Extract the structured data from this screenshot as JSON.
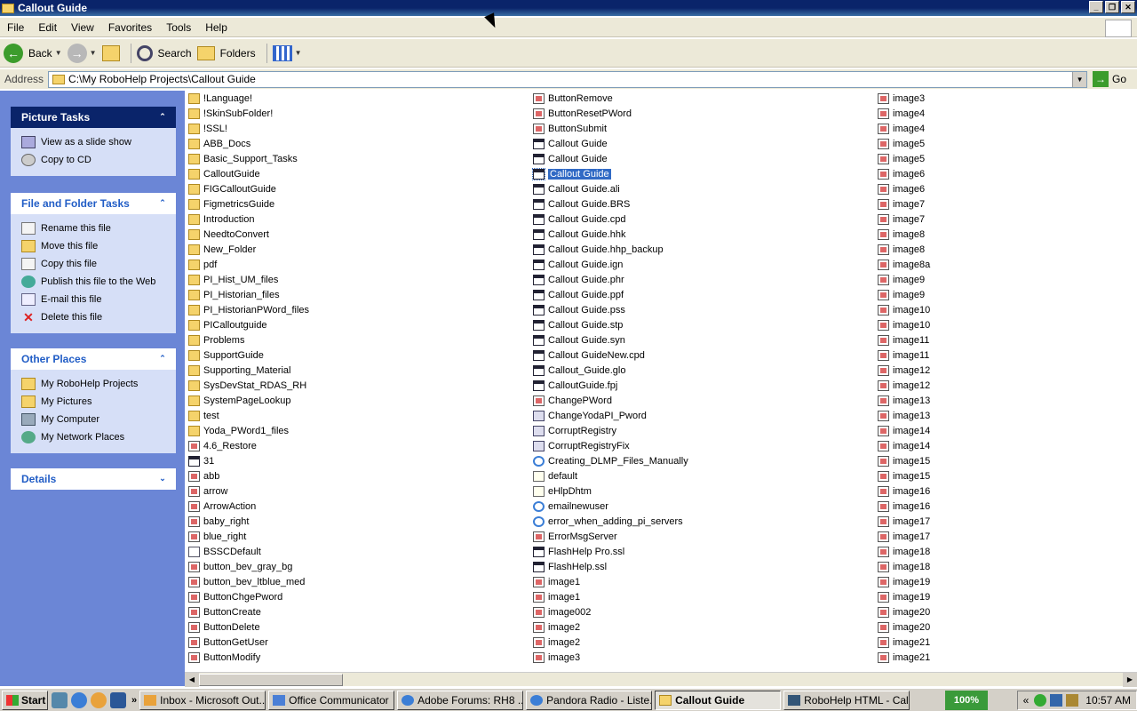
{
  "window": {
    "title": "Callout Guide"
  },
  "menu": [
    "File",
    "Edit",
    "View",
    "Favorites",
    "Tools",
    "Help"
  ],
  "toolbar": {
    "back": "Back",
    "search": "Search",
    "folders": "Folders"
  },
  "address": {
    "label": "Address",
    "value": "C:\\My RoboHelp Projects\\Callout Guide",
    "go": "Go"
  },
  "panels": {
    "picture_tasks": {
      "title": "Picture Tasks",
      "items": [
        "View as a slide show",
        "Copy to CD"
      ]
    },
    "file_tasks": {
      "title": "File and Folder Tasks",
      "items": [
        "Rename this file",
        "Move this file",
        "Copy this file",
        "Publish this file to the Web",
        "E-mail this file",
        "Delete this file"
      ]
    },
    "other_places": {
      "title": "Other Places",
      "items": [
        "My RoboHelp Projects",
        "My Pictures",
        "My Computer",
        "My Network Places"
      ]
    },
    "details": {
      "title": "Details"
    }
  },
  "columns": [
    [
      {
        "n": "!Language!",
        "t": "folder"
      },
      {
        "n": "!SkinSubFolder!",
        "t": "folder"
      },
      {
        "n": "!SSL!",
        "t": "folder"
      },
      {
        "n": "ABB_Docs",
        "t": "folder"
      },
      {
        "n": "Basic_Support_Tasks",
        "t": "folder"
      },
      {
        "n": "CalloutGuide",
        "t": "folder"
      },
      {
        "n": "FIGCalloutGuide",
        "t": "folder"
      },
      {
        "n": "FigmetricsGuide",
        "t": "folder"
      },
      {
        "n": "Introduction",
        "t": "folder"
      },
      {
        "n": "NeedtoConvert",
        "t": "folder"
      },
      {
        "n": "New_Folder",
        "t": "folder"
      },
      {
        "n": "pdf",
        "t": "folder"
      },
      {
        "n": "PI_Hist_UM_files",
        "t": "folder"
      },
      {
        "n": "PI_Historian_files",
        "t": "folder"
      },
      {
        "n": "PI_HistorianPWord_files",
        "t": "folder"
      },
      {
        "n": "PICalloutguide",
        "t": "folder"
      },
      {
        "n": "Problems",
        "t": "folder"
      },
      {
        "n": "SupportGuide",
        "t": "folder"
      },
      {
        "n": "Supporting_Material",
        "t": "folder"
      },
      {
        "n": "SysDevStat_RDAS_RH",
        "t": "folder"
      },
      {
        "n": "SystemPageLookup",
        "t": "folder"
      },
      {
        "n": "test",
        "t": "folder"
      },
      {
        "n": "Yoda_PWord1_files",
        "t": "folder"
      },
      {
        "n": "4.6_Restore",
        "t": "image"
      },
      {
        "n": "31",
        "t": "app"
      },
      {
        "n": "abb",
        "t": "image"
      },
      {
        "n": "arrow",
        "t": "image"
      },
      {
        "n": "ArrowAction",
        "t": "image"
      },
      {
        "n": "baby_right",
        "t": "image"
      },
      {
        "n": "blue_right",
        "t": "image"
      },
      {
        "n": "BSSCDefault",
        "t": "doc"
      },
      {
        "n": "button_bev_gray_bg",
        "t": "image"
      },
      {
        "n": "button_bev_ltblue_med",
        "t": "image"
      },
      {
        "n": "ButtonChgePword",
        "t": "image"
      },
      {
        "n": "ButtonCreate",
        "t": "image"
      },
      {
        "n": "ButtonDelete",
        "t": "image"
      },
      {
        "n": "ButtonGetUser",
        "t": "image"
      },
      {
        "n": "ButtonModify",
        "t": "image"
      }
    ],
    [
      {
        "n": "ButtonRemove",
        "t": "image"
      },
      {
        "n": "ButtonResetPWord",
        "t": "image"
      },
      {
        "n": "ButtonSubmit",
        "t": "image"
      },
      {
        "n": "Callout Guide",
        "t": "app"
      },
      {
        "n": "Callout Guide",
        "t": "app"
      },
      {
        "n": "Callout Guide",
        "t": "app",
        "sel": true
      },
      {
        "n": "Callout Guide.ali",
        "t": "app"
      },
      {
        "n": "Callout Guide.BRS",
        "t": "app"
      },
      {
        "n": "Callout Guide.cpd",
        "t": "app"
      },
      {
        "n": "Callout Guide.hhk",
        "t": "app"
      },
      {
        "n": "Callout Guide.hhp_backup",
        "t": "app"
      },
      {
        "n": "Callout Guide.ign",
        "t": "app"
      },
      {
        "n": "Callout Guide.phr",
        "t": "app"
      },
      {
        "n": "Callout Guide.ppf",
        "t": "app"
      },
      {
        "n": "Callout Guide.pss",
        "t": "app"
      },
      {
        "n": "Callout Guide.stp",
        "t": "app"
      },
      {
        "n": "Callout Guide.syn",
        "t": "app"
      },
      {
        "n": "Callout GuideNew.cpd",
        "t": "app"
      },
      {
        "n": "Callout_Guide.glo",
        "t": "app"
      },
      {
        "n": "CalloutGuide.fpj",
        "t": "app"
      },
      {
        "n": "ChangePWord",
        "t": "image"
      },
      {
        "n": "ChangeYodaPI_Pword",
        "t": "reg"
      },
      {
        "n": "CorruptRegistry",
        "t": "reg"
      },
      {
        "n": "CorruptRegistryFix",
        "t": "reg"
      },
      {
        "n": "Creating_DLMP_Files_Manually",
        "t": "ie"
      },
      {
        "n": "default",
        "t": "exe"
      },
      {
        "n": "eHlpDhtm",
        "t": "exe"
      },
      {
        "n": "emailnewuser",
        "t": "ie"
      },
      {
        "n": "error_when_adding_pi_servers",
        "t": "ie"
      },
      {
        "n": "ErrorMsgServer",
        "t": "image"
      },
      {
        "n": "FlashHelp Pro.ssl",
        "t": "app"
      },
      {
        "n": "FlashHelp.ssl",
        "t": "app"
      },
      {
        "n": "image1",
        "t": "image"
      },
      {
        "n": "image1",
        "t": "image"
      },
      {
        "n": "image002",
        "t": "image"
      },
      {
        "n": "image2",
        "t": "image"
      },
      {
        "n": "image2",
        "t": "image"
      },
      {
        "n": "image3",
        "t": "image"
      }
    ],
    [
      {
        "n": "image3",
        "t": "image"
      },
      {
        "n": "image4",
        "t": "image"
      },
      {
        "n": "image4",
        "t": "image"
      },
      {
        "n": "image5",
        "t": "image"
      },
      {
        "n": "image5",
        "t": "image"
      },
      {
        "n": "image6",
        "t": "image"
      },
      {
        "n": "image6",
        "t": "image"
      },
      {
        "n": "image7",
        "t": "image"
      },
      {
        "n": "image7",
        "t": "image"
      },
      {
        "n": "image8",
        "t": "image"
      },
      {
        "n": "image8",
        "t": "image"
      },
      {
        "n": "image8a",
        "t": "image"
      },
      {
        "n": "image9",
        "t": "image"
      },
      {
        "n": "image9",
        "t": "image"
      },
      {
        "n": "image10",
        "t": "image"
      },
      {
        "n": "image10",
        "t": "image"
      },
      {
        "n": "image11",
        "t": "image"
      },
      {
        "n": "image11",
        "t": "image"
      },
      {
        "n": "image12",
        "t": "image"
      },
      {
        "n": "image12",
        "t": "image"
      },
      {
        "n": "image13",
        "t": "image"
      },
      {
        "n": "image13",
        "t": "image"
      },
      {
        "n": "image14",
        "t": "image"
      },
      {
        "n": "image14",
        "t": "image"
      },
      {
        "n": "image15",
        "t": "image"
      },
      {
        "n": "image15",
        "t": "image"
      },
      {
        "n": "image16",
        "t": "image"
      },
      {
        "n": "image16",
        "t": "image"
      },
      {
        "n": "image17",
        "t": "image"
      },
      {
        "n": "image17",
        "t": "image"
      },
      {
        "n": "image18",
        "t": "image"
      },
      {
        "n": "image18",
        "t": "image"
      },
      {
        "n": "image19",
        "t": "image"
      },
      {
        "n": "image19",
        "t": "image"
      },
      {
        "n": "image20",
        "t": "image"
      },
      {
        "n": "image20",
        "t": "image"
      },
      {
        "n": "image21",
        "t": "image"
      },
      {
        "n": "image21",
        "t": "image"
      }
    ]
  ],
  "taskbar": {
    "start": "Start",
    "buttons": [
      "Inbox - Microsoft Out...",
      "Office Communicator",
      "Adobe Forums: RH8 ...",
      "Pandora Radio - Liste...",
      "Callout Guide",
      "RoboHelp HTML - Call..."
    ],
    "active": "Callout Guide",
    "zoom": "100%",
    "clock": "10:57 AM"
  }
}
